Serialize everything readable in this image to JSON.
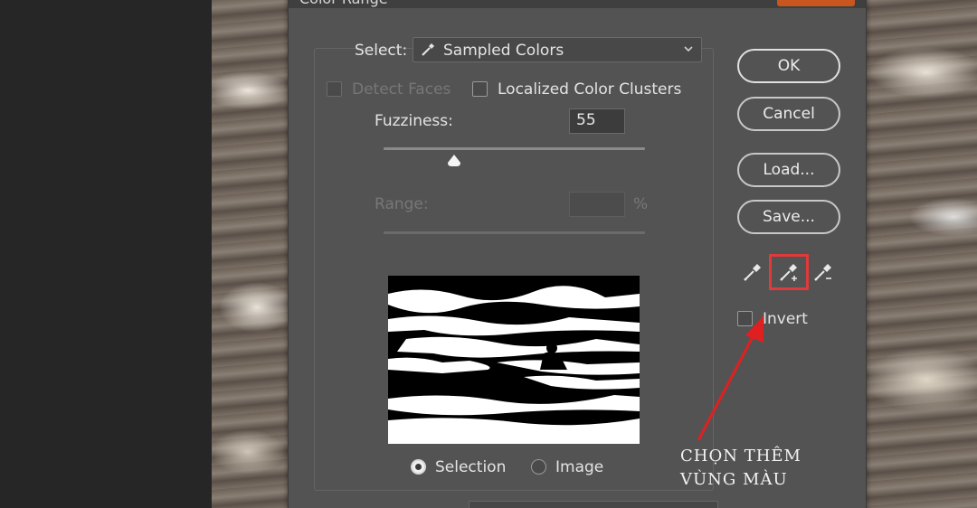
{
  "dialog": {
    "title": "Color Range"
  },
  "select": {
    "label": "Select:",
    "value": "Sampled Colors"
  },
  "options": {
    "detect_faces": {
      "label": "Detect Faces",
      "checked": false,
      "enabled": false
    },
    "localized_clusters": {
      "label": "Localized Color Clusters",
      "checked": false
    }
  },
  "fuzziness": {
    "label": "Fuzziness:",
    "value": "55",
    "slider_fraction": 0.27
  },
  "range": {
    "label": "Range:",
    "value": "",
    "unit": "%",
    "enabled": false
  },
  "preview_mode": {
    "selection_label": "Selection",
    "image_label": "Image",
    "selected": "Selection"
  },
  "buttons": {
    "ok": "OK",
    "cancel": "Cancel",
    "load": "Load...",
    "save": "Save..."
  },
  "eyedroppers": {
    "tools": [
      "eyedropper-icon",
      "eyedropper-plus-icon",
      "eyedropper-minus-icon"
    ],
    "active": "eyedropper-plus-icon"
  },
  "invert": {
    "label": "Invert",
    "checked": false
  },
  "annotation": {
    "line1": "CHỌN THÊM",
    "line2": "VÙNG MÀU",
    "color": "#e02020"
  },
  "colors": {
    "dialog_bg": "#535353",
    "highlight": "#e03a3a",
    "close_button": "#c9561f"
  }
}
